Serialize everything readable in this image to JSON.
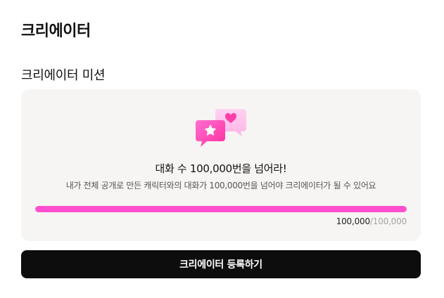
{
  "page": {
    "title": "크리에이터"
  },
  "mission": {
    "section_title": "크리에이터 미션",
    "icon": "chat-bubbles-star-heart-icon",
    "title": "대화 수 100,000번을 넘어라!",
    "description": "내가 전체 공개로 만든 캐릭터와의 대화가 100,000번을 넘어야 크리에이터가 될 수 있어요",
    "progress": {
      "current": "100,000",
      "separator": "/",
      "goal": "100,000",
      "fraction": 1.0
    }
  },
  "actions": {
    "register_label": "크리에이터 등록하기"
  },
  "colors": {
    "accent": "#ff4fcf",
    "card_bg": "#f6f5f3",
    "button_bg": "#0d0d0d",
    "button_text": "#ffffff"
  }
}
